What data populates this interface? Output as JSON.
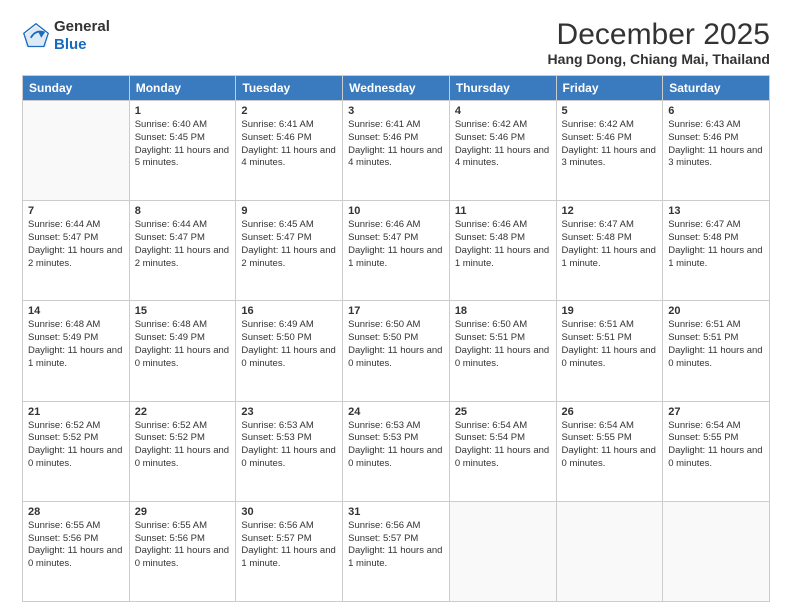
{
  "logo": {
    "general": "General",
    "blue": "Blue"
  },
  "header": {
    "month_title": "December 2025",
    "location": "Hang Dong, Chiang Mai, Thailand"
  },
  "days_of_week": [
    "Sunday",
    "Monday",
    "Tuesday",
    "Wednesday",
    "Thursday",
    "Friday",
    "Saturday"
  ],
  "weeks": [
    [
      {
        "day": "",
        "info": ""
      },
      {
        "day": "1",
        "info": "Sunrise: 6:40 AM\nSunset: 5:45 PM\nDaylight: 11 hours and 5 minutes."
      },
      {
        "day": "2",
        "info": "Sunrise: 6:41 AM\nSunset: 5:46 PM\nDaylight: 11 hours and 4 minutes."
      },
      {
        "day": "3",
        "info": "Sunrise: 6:41 AM\nSunset: 5:46 PM\nDaylight: 11 hours and 4 minutes."
      },
      {
        "day": "4",
        "info": "Sunrise: 6:42 AM\nSunset: 5:46 PM\nDaylight: 11 hours and 4 minutes."
      },
      {
        "day": "5",
        "info": "Sunrise: 6:42 AM\nSunset: 5:46 PM\nDaylight: 11 hours and 3 minutes."
      },
      {
        "day": "6",
        "info": "Sunrise: 6:43 AM\nSunset: 5:46 PM\nDaylight: 11 hours and 3 minutes."
      }
    ],
    [
      {
        "day": "7",
        "info": "Sunrise: 6:44 AM\nSunset: 5:47 PM\nDaylight: 11 hours and 2 minutes."
      },
      {
        "day": "8",
        "info": "Sunrise: 6:44 AM\nSunset: 5:47 PM\nDaylight: 11 hours and 2 minutes."
      },
      {
        "day": "9",
        "info": "Sunrise: 6:45 AM\nSunset: 5:47 PM\nDaylight: 11 hours and 2 minutes."
      },
      {
        "day": "10",
        "info": "Sunrise: 6:46 AM\nSunset: 5:47 PM\nDaylight: 11 hours and 1 minute."
      },
      {
        "day": "11",
        "info": "Sunrise: 6:46 AM\nSunset: 5:48 PM\nDaylight: 11 hours and 1 minute."
      },
      {
        "day": "12",
        "info": "Sunrise: 6:47 AM\nSunset: 5:48 PM\nDaylight: 11 hours and 1 minute."
      },
      {
        "day": "13",
        "info": "Sunrise: 6:47 AM\nSunset: 5:48 PM\nDaylight: 11 hours and 1 minute."
      }
    ],
    [
      {
        "day": "14",
        "info": "Sunrise: 6:48 AM\nSunset: 5:49 PM\nDaylight: 11 hours and 1 minute."
      },
      {
        "day": "15",
        "info": "Sunrise: 6:48 AM\nSunset: 5:49 PM\nDaylight: 11 hours and 0 minutes."
      },
      {
        "day": "16",
        "info": "Sunrise: 6:49 AM\nSunset: 5:50 PM\nDaylight: 11 hours and 0 minutes."
      },
      {
        "day": "17",
        "info": "Sunrise: 6:50 AM\nSunset: 5:50 PM\nDaylight: 11 hours and 0 minutes."
      },
      {
        "day": "18",
        "info": "Sunrise: 6:50 AM\nSunset: 5:51 PM\nDaylight: 11 hours and 0 minutes."
      },
      {
        "day": "19",
        "info": "Sunrise: 6:51 AM\nSunset: 5:51 PM\nDaylight: 11 hours and 0 minutes."
      },
      {
        "day": "20",
        "info": "Sunrise: 6:51 AM\nSunset: 5:51 PM\nDaylight: 11 hours and 0 minutes."
      }
    ],
    [
      {
        "day": "21",
        "info": "Sunrise: 6:52 AM\nSunset: 5:52 PM\nDaylight: 11 hours and 0 minutes."
      },
      {
        "day": "22",
        "info": "Sunrise: 6:52 AM\nSunset: 5:52 PM\nDaylight: 11 hours and 0 minutes."
      },
      {
        "day": "23",
        "info": "Sunrise: 6:53 AM\nSunset: 5:53 PM\nDaylight: 11 hours and 0 minutes."
      },
      {
        "day": "24",
        "info": "Sunrise: 6:53 AM\nSunset: 5:53 PM\nDaylight: 11 hours and 0 minutes."
      },
      {
        "day": "25",
        "info": "Sunrise: 6:54 AM\nSunset: 5:54 PM\nDaylight: 11 hours and 0 minutes."
      },
      {
        "day": "26",
        "info": "Sunrise: 6:54 AM\nSunset: 5:55 PM\nDaylight: 11 hours and 0 minutes."
      },
      {
        "day": "27",
        "info": "Sunrise: 6:54 AM\nSunset: 5:55 PM\nDaylight: 11 hours and 0 minutes."
      }
    ],
    [
      {
        "day": "28",
        "info": "Sunrise: 6:55 AM\nSunset: 5:56 PM\nDaylight: 11 hours and 0 minutes."
      },
      {
        "day": "29",
        "info": "Sunrise: 6:55 AM\nSunset: 5:56 PM\nDaylight: 11 hours and 0 minutes."
      },
      {
        "day": "30",
        "info": "Sunrise: 6:56 AM\nSunset: 5:57 PM\nDaylight: 11 hours and 1 minute."
      },
      {
        "day": "31",
        "info": "Sunrise: 6:56 AM\nSunset: 5:57 PM\nDaylight: 11 hours and 1 minute."
      },
      {
        "day": "",
        "info": ""
      },
      {
        "day": "",
        "info": ""
      },
      {
        "day": "",
        "info": ""
      }
    ]
  ]
}
